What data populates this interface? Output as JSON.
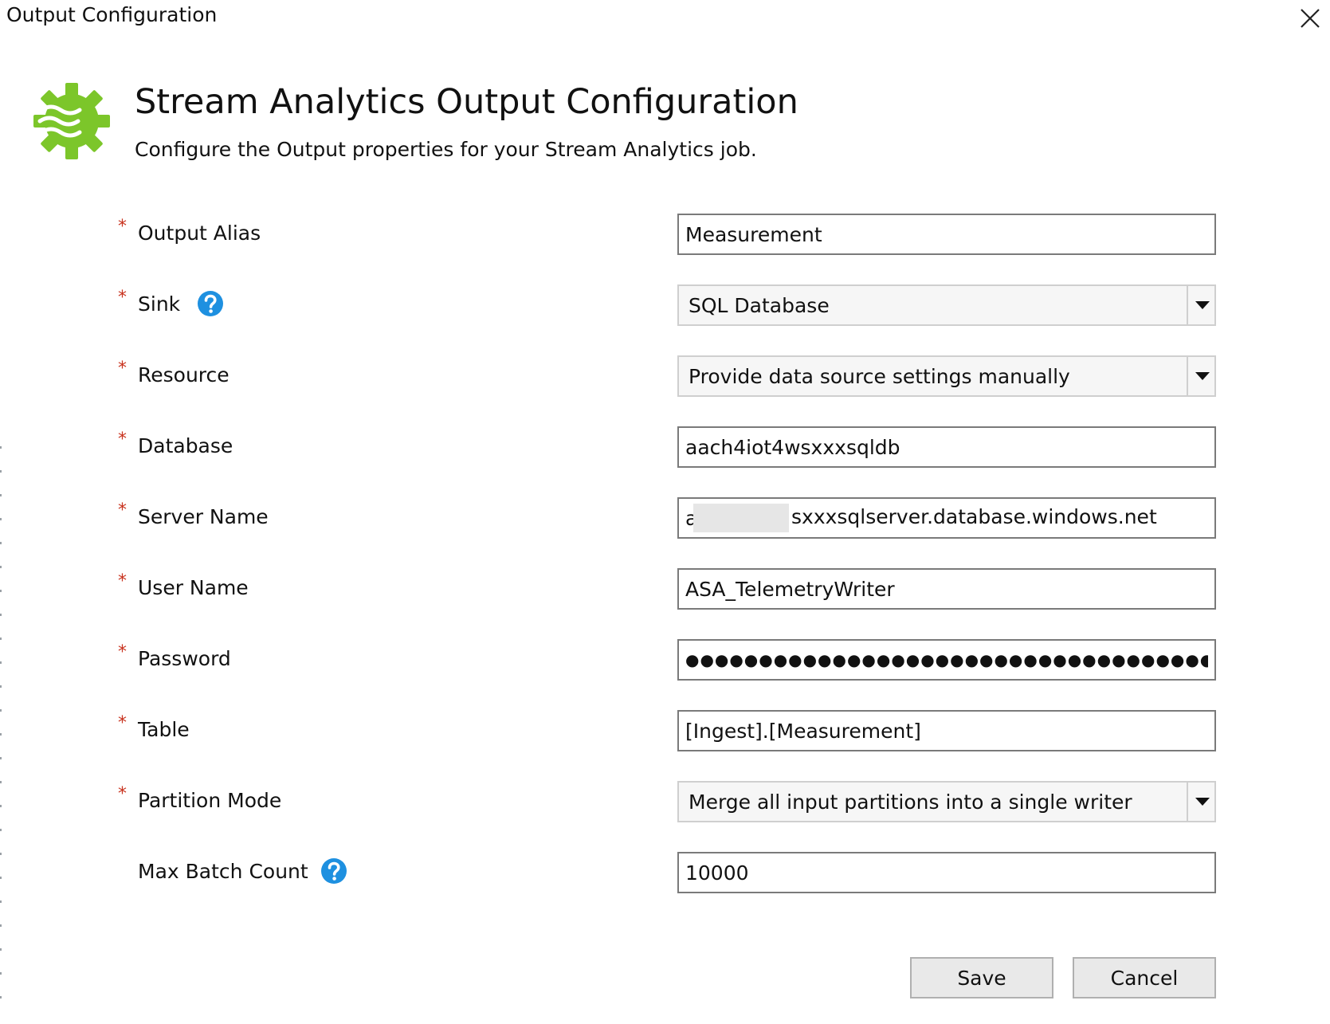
{
  "window": {
    "title": "Output Configuration"
  },
  "header": {
    "title": "Stream Analytics Output Configuration",
    "subtitle": "Configure the Output properties for your Stream Analytics job."
  },
  "fields": {
    "output_alias": {
      "label": "Output Alias",
      "required": "*",
      "value": "Measurement"
    },
    "sink": {
      "label": "Sink",
      "required": "*",
      "value": "SQL Database"
    },
    "resource": {
      "label": "Resource",
      "required": "*",
      "value": "Provide data source settings manually"
    },
    "database": {
      "label": "Database",
      "required": "*",
      "value": "aach4iot4wsxxxsqldb"
    },
    "server_name": {
      "label": "Server Name",
      "required": "*",
      "value_prefix": "a",
      "value_suffix": "sxxxsqlserver.database.windows.net"
    },
    "user_name": {
      "label": "User Name",
      "required": "*",
      "value": "ASA_TelemetryWriter"
    },
    "password": {
      "label": "Password",
      "required": "*",
      "value": "●●●●●●●●●●●●●●●●●●●●●●●●●●●●●●●●●●●●●●●●●●●●"
    },
    "table": {
      "label": "Table",
      "required": "*",
      "value": "[Ingest].[Measurement]"
    },
    "partition_mode": {
      "label": "Partition Mode",
      "required": "*",
      "value": "Merge all input partitions into a single writer"
    },
    "max_batch_count": {
      "label": "Max Batch Count",
      "value": "10000"
    }
  },
  "buttons": {
    "save": "Save",
    "cancel": "Cancel"
  },
  "icons": {
    "app": "stream-analytics-gear-icon",
    "help": "question-mark-icon",
    "close": "close-icon",
    "dropdown": "chevron-down-icon"
  },
  "colors": {
    "accent_green": "#7cc62a",
    "help_blue": "#1e90e0",
    "required_red": "#c8321e"
  }
}
